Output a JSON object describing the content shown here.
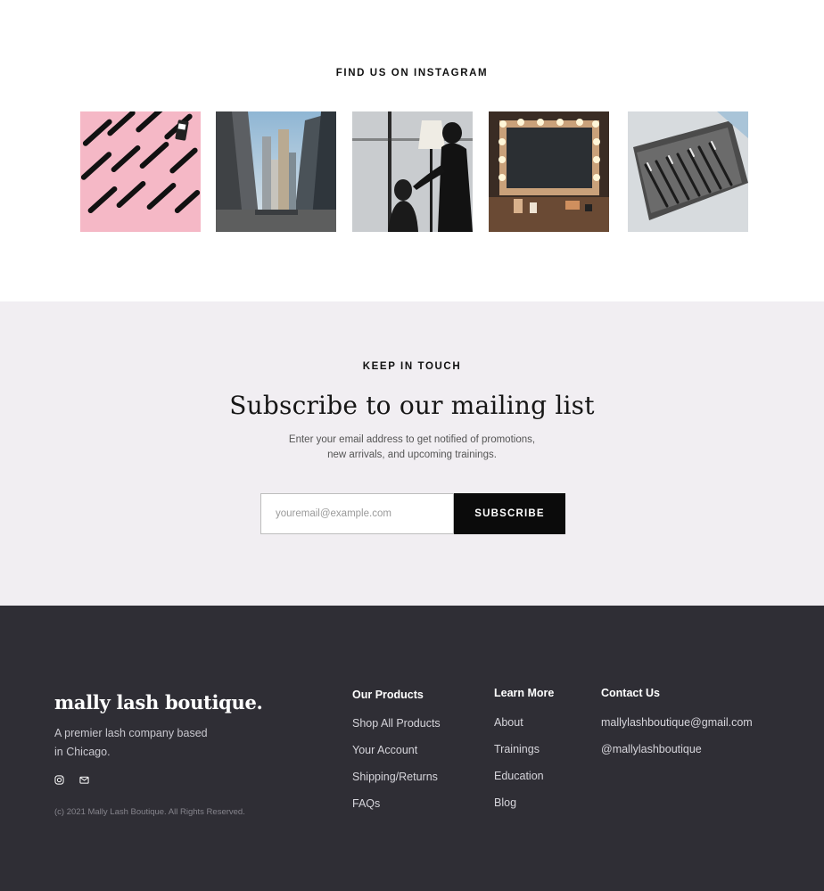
{
  "instagram": {
    "heading": "FIND US ON INSTAGRAM",
    "tiles": [
      {
        "icon": "lash-tools-on-pink-photo"
      },
      {
        "icon": "chicago-street-photo"
      },
      {
        "icon": "lash-artist-at-work-photo"
      },
      {
        "icon": "vanity-mirror-photo"
      },
      {
        "icon": "makeup-brush-set-photo"
      }
    ]
  },
  "newsletter": {
    "kicker": "KEEP IN TOUCH",
    "title": "Subscribe to our mailing list",
    "description": "Enter your email address to get notified of promotions, new arrivals, and upcoming trainings.",
    "email_placeholder": "youremail@example.com",
    "email_value": "",
    "subscribe_label": "SUBSCRIBE"
  },
  "footer": {
    "brand": "mally lash boutique.",
    "tagline": "A premier lash company based in Chicago.",
    "social_icons": [
      "instagram-icon",
      "email-icon"
    ],
    "copyright": "(c) 2021 Mally Lash Boutique. All Rights Reserved.",
    "columns": {
      "products": {
        "heading": "Our Products",
        "links": [
          "Shop All Products",
          "Your Account",
          "Shipping/Returns",
          "FAQs"
        ]
      },
      "learn": {
        "heading": "Learn More",
        "links": [
          "About",
          "Trainings",
          "Education",
          "Blog"
        ]
      },
      "contact": {
        "heading": "Contact Us",
        "links": [
          "mallylashboutique@gmail.com",
          "@mallylashboutique"
        ]
      }
    }
  },
  "colors": {
    "newsletter_bg": "#f1eef2",
    "footer_bg": "#2f2e35",
    "button_bg": "#0b0b0b"
  }
}
